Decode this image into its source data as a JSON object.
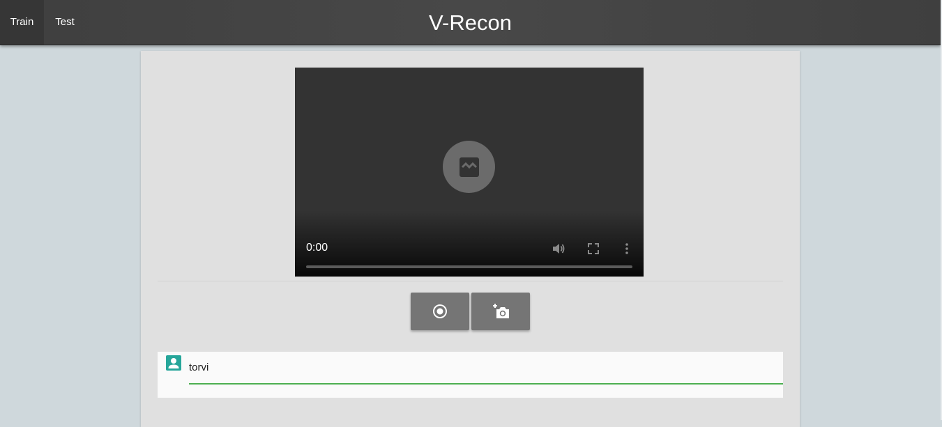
{
  "app": {
    "title": "V-Recon"
  },
  "nav": {
    "tabs": [
      {
        "label": "Train",
        "active": true
      },
      {
        "label": "Test",
        "active": false
      }
    ]
  },
  "video": {
    "time": "0:00",
    "progress": 0,
    "icons": [
      "broken-image-icon",
      "volume-icon",
      "fullscreen-icon",
      "more-vert-icon"
    ]
  },
  "actions": {
    "record_icon": "record-icon",
    "capture_icon": "add-photo-icon"
  },
  "name_field": {
    "value": "torvi",
    "icon": "account-box-icon"
  },
  "colors": {
    "toolbar": "#424242",
    "background": "#cfd8dc",
    "card": "#e0e0e0",
    "button": "#757575",
    "accent_teal": "#26a69a",
    "underline_green": "#4caf50"
  }
}
